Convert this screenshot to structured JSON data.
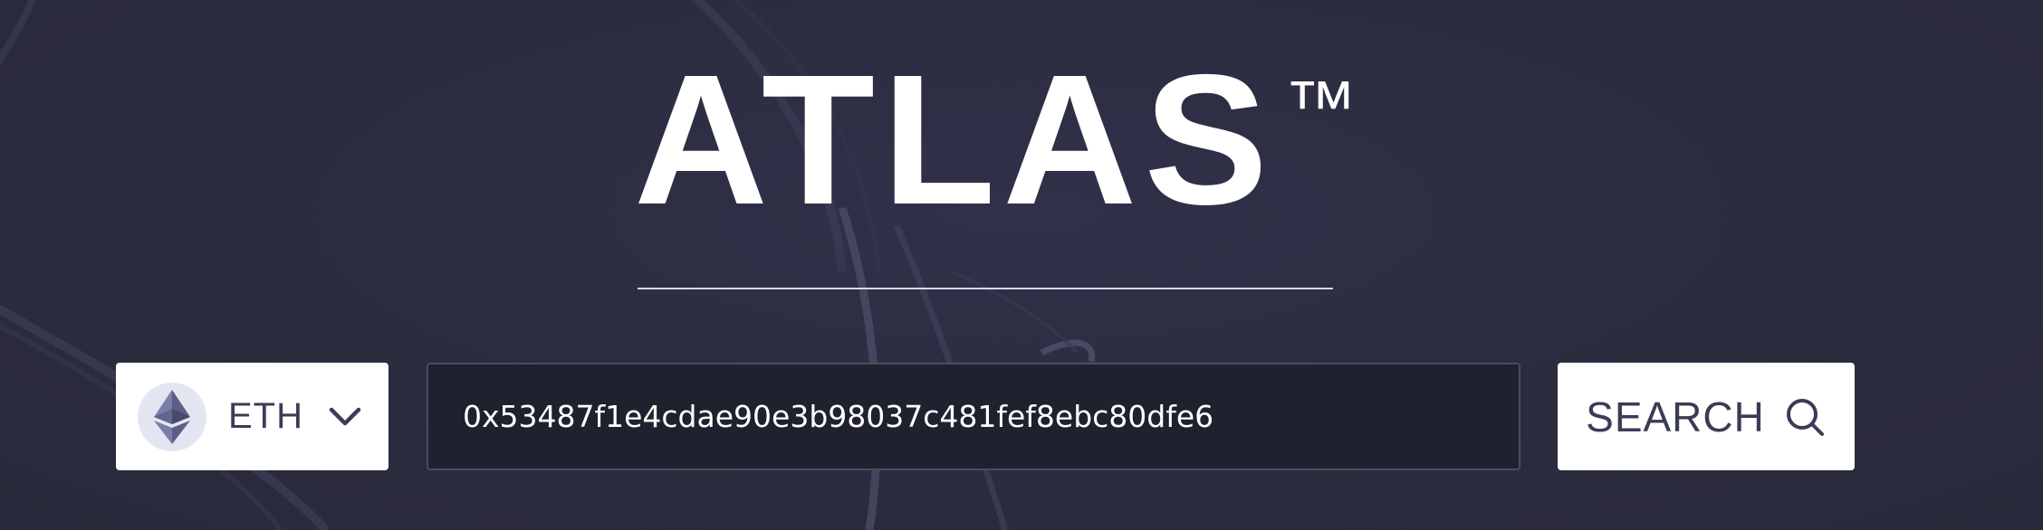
{
  "brand": {
    "name": "ATLAS",
    "trademark": "™"
  },
  "search": {
    "chain": {
      "label": "ETH",
      "icon": "ethereum-icon"
    },
    "query": "0x53487f1e4cdae90e3b98037c481fef8ebc80dfe6",
    "button_label": "SEARCH",
    "button_icon": "search-icon"
  },
  "colors": {
    "background": "#2c2d3f",
    "input_background": "#20212f",
    "button_background": "#ffffff",
    "button_text": "#3a3c56",
    "logo": "#ffffff"
  }
}
